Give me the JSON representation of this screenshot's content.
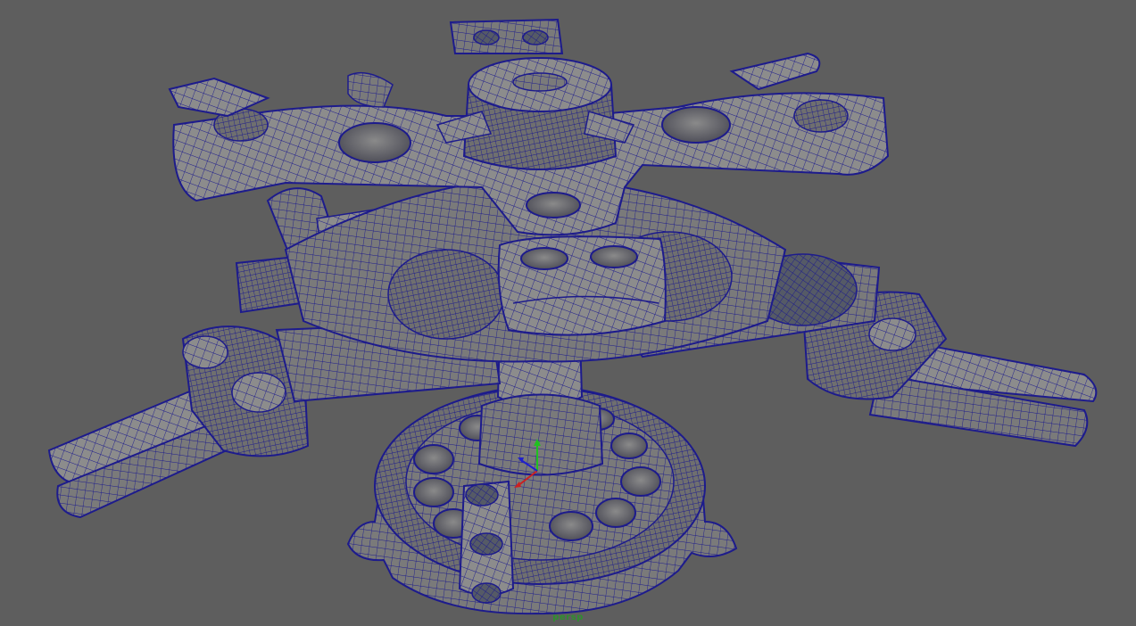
{
  "viewport": {
    "camera_label": "persp",
    "background_color": "#5e5e5e",
    "wire_color": "#1c1a8a",
    "shade_color": "#7d7d7d",
    "label_color": "#2f8f2f"
  },
  "model": {
    "name_icon": "rotor-hub-mesh-icon"
  },
  "manipulator": {
    "icon": "axis-gizmo-icon",
    "axes": [
      {
        "axis": "x",
        "color": "#cc2020"
      },
      {
        "axis": "y",
        "color": "#20c020"
      },
      {
        "axis": "z",
        "color": "#2020cc"
      }
    ]
  }
}
